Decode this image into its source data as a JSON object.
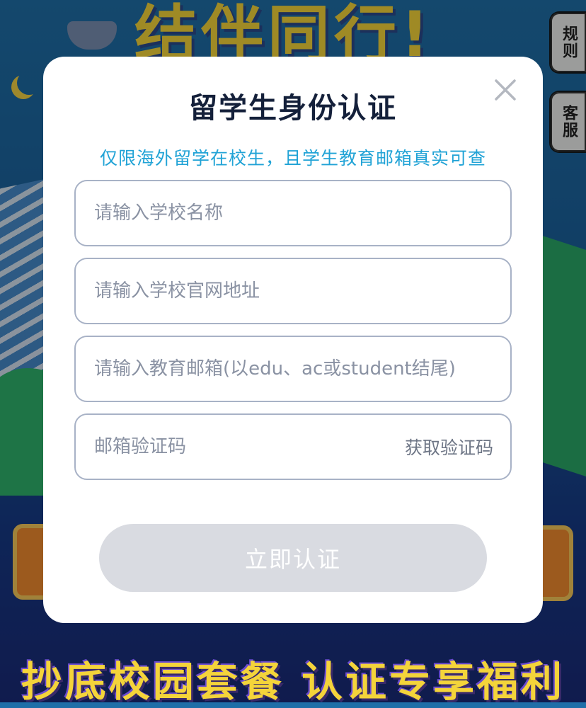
{
  "background": {
    "headline": "结伴同行!",
    "banner": "抄底校园套餐 认证专享福利"
  },
  "side_tabs": {
    "rules": "规则",
    "service": "客服"
  },
  "modal": {
    "title": "留学生身份认证",
    "subtitle": "仅限海外留学在校生，且学生教育邮箱真实可查",
    "fields": [
      {
        "placeholder": "请输入学校名称",
        "value": ""
      },
      {
        "placeholder": "请输入学校官网地址",
        "value": ""
      },
      {
        "placeholder": "请输入教育邮箱(以edu、ac或student结尾)",
        "value": ""
      },
      {
        "placeholder": "邮箱验证码",
        "value": ""
      }
    ],
    "get_code_label": "获取验证码",
    "submit_label": "立即认证"
  },
  "colors": {
    "accent": "#21a3d6",
    "title": "#14203a",
    "button_disabled": "#d9dbe1"
  }
}
